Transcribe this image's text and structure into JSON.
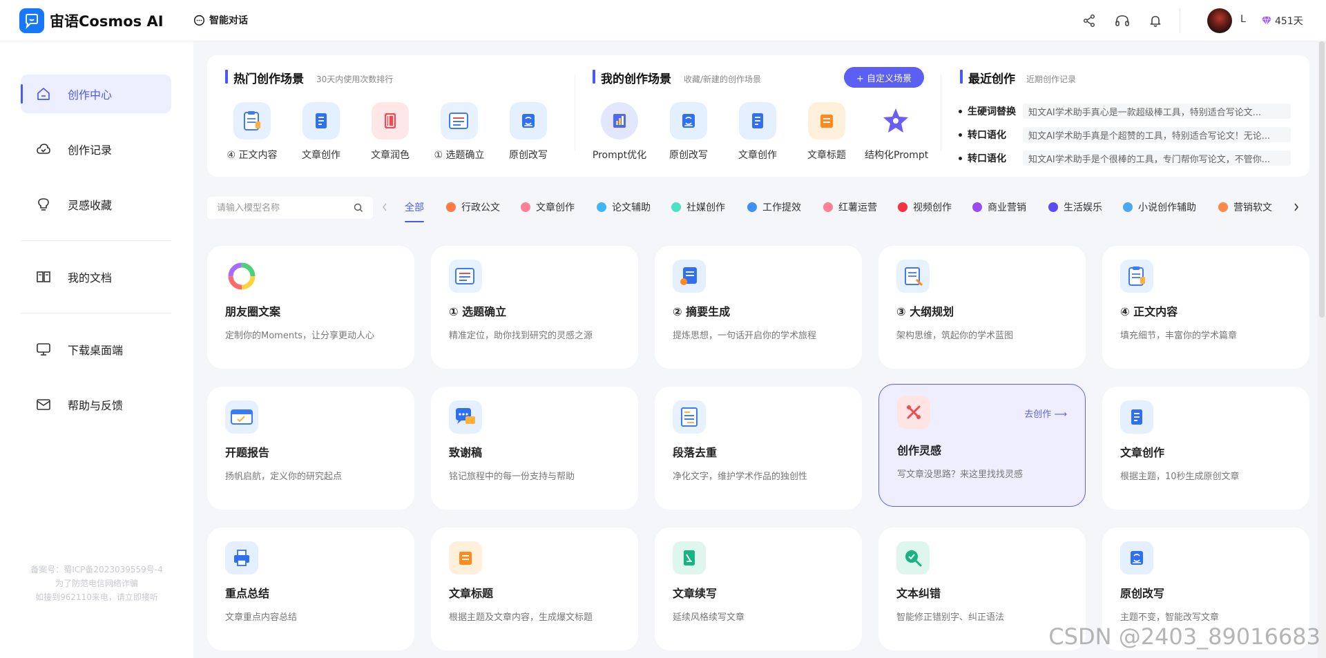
{
  "app": {
    "name": "宙语Cosmos AI",
    "nav_item": "智能对话"
  },
  "header": {
    "user_name": "L",
    "vip_days": "451天"
  },
  "sidebar": {
    "items": [
      {
        "label": "创作中心",
        "icon": "home-icon",
        "active": true
      },
      {
        "label": "创作记录",
        "icon": "cloud-icon"
      },
      {
        "label": "灵感收藏",
        "icon": "lightbulb-icon"
      },
      {
        "label": "我的文档",
        "icon": "book-icon"
      },
      {
        "label": "下载桌面端",
        "icon": "monitor-icon"
      },
      {
        "label": "帮助与反馈",
        "icon": "mail-icon"
      }
    ],
    "footer": [
      "备案号：蜀ICP备2023039559号-4",
      "为了防范电信网络诈骗",
      "如接到962110来电，请立即接听"
    ]
  },
  "hot": {
    "title": "热门创作场景",
    "subtitle": "30天内使用次数排行",
    "items": [
      {
        "label": "④ 正文内容",
        "icon": "clipboard-icon",
        "color": "#e7f0ff"
      },
      {
        "label": "文章创作",
        "icon": "document-icon",
        "color": "#e4efff"
      },
      {
        "label": "文章润色",
        "icon": "notebook-icon",
        "color": "#ffe7e7"
      },
      {
        "label": "① 选题确立",
        "icon": "checklist-icon",
        "color": "#e8f2ff"
      },
      {
        "label": "原创改写",
        "icon": "rewrite-icon",
        "color": "#e4f0ff"
      }
    ]
  },
  "mine": {
    "title": "我的创作场景",
    "subtitle": "收藏/新建的创作场景",
    "custom_button": "+ 自定义场景",
    "items": [
      {
        "label": "Prompt优化",
        "icon": "prompt-chart-icon",
        "color": "#e2e6ff"
      },
      {
        "label": "原创改写",
        "icon": "rewrite-icon",
        "color": "#e4f0ff"
      },
      {
        "label": "文章创作",
        "icon": "document-icon",
        "color": "#e4efff"
      },
      {
        "label": "文章标题",
        "icon": "title-book-icon",
        "color": "#fff0dc"
      },
      {
        "label": "结构化Prompt",
        "icon": "star-icon",
        "color": "#ffffff"
      }
    ]
  },
  "recent": {
    "title": "最近创作",
    "subtitle": "近期创作记录",
    "items": [
      {
        "tag": "生硬词替换",
        "text": "知文AI学术助手真心是一款超级棒工具，特别适合写论文..."
      },
      {
        "tag": "转口语化",
        "text": "知文AI学术助手真是个超赞的工具，特别适合写论文！无论..."
      },
      {
        "tag": "转口语化",
        "text": "知文AI学术助手是个很棒的工具，专门帮你写论文，不管你..."
      }
    ]
  },
  "search": {
    "placeholder": "请输入模型名称"
  },
  "categories": [
    {
      "label": "全部",
      "active": true
    },
    {
      "label": "行政公文",
      "color": "#ff7a45"
    },
    {
      "label": "文章创作",
      "color": "#ff7f96"
    },
    {
      "label": "论文辅助",
      "color": "#40b7f5"
    },
    {
      "label": "社媒创作",
      "color": "#4ee0c0"
    },
    {
      "label": "工作提效",
      "color": "#3c91f5"
    },
    {
      "label": "红薯运营",
      "color": "#ff7f96"
    },
    {
      "label": "视频创作",
      "color": "#f5333f"
    },
    {
      "label": "商业营销",
      "color": "#9b4cf0"
    },
    {
      "label": "生活娱乐",
      "color": "#5a4cf0"
    },
    {
      "label": "小说创作辅助",
      "color": "#4aa8f5"
    },
    {
      "label": "营销软文",
      "color": "#ff8a45"
    }
  ],
  "cards": [
    {
      "title": "朋友圈文案",
      "desc": "定制你的Moments，让分享更动人心",
      "icon": "ring-icon",
      "color": "#ffffff"
    },
    {
      "title": "① 选题确立",
      "desc": "精准定位，助你找到研究的灵感之源",
      "icon": "checklist-icon",
      "color": "#e8f2ff"
    },
    {
      "title": "② 摘要生成",
      "desc": "提炼思想，一句话开启你的学术旅程",
      "icon": "summary-icon",
      "color": "#e4efff"
    },
    {
      "title": "③ 大纲规划",
      "desc": "架构思维，筑起你的学术蓝图",
      "icon": "outline-icon",
      "color": "#e8f2ff"
    },
    {
      "title": "④ 正文内容",
      "desc": "填充细节，丰富你的学术篇章",
      "icon": "clipboard-icon",
      "color": "#e7f0ff"
    },
    {
      "title": "开题报告",
      "desc": "扬帆启航，定义你的研究起点",
      "icon": "report-icon",
      "color": "#e6f0ff"
    },
    {
      "title": "致谢稿",
      "desc": "铭记旅程中的每一份支持与帮助",
      "icon": "chat-icon",
      "color": "#e4efff"
    },
    {
      "title": "段落去重",
      "desc": "净化文字，维护学术作品的独创性",
      "icon": "dedupe-icon",
      "color": "#e8f2ff"
    },
    {
      "title": "创作灵感",
      "desc": "写文章没思路？来这里找找灵感",
      "icon": "inspiration-icon",
      "color": "#ffe4e4",
      "go": "去创作 ⟶",
      "highlight": true
    },
    {
      "title": "文章创作",
      "desc": "根据主题，10秒生成原创文章",
      "icon": "document-icon",
      "color": "#e4efff"
    },
    {
      "title": "重点总结",
      "desc": "文章重点内容总结",
      "icon": "printer-icon",
      "color": "#e4efff"
    },
    {
      "title": "文章标题",
      "desc": "根据主题及文章内容，生成爆文标题",
      "icon": "title-book-icon",
      "color": "#fff0dc"
    },
    {
      "title": "文章续写",
      "desc": "延续风格续写文章",
      "icon": "continue-icon",
      "color": "#dff6ee"
    },
    {
      "title": "文本纠错",
      "desc": "智能修正错别字、纠正语法",
      "icon": "correct-icon",
      "color": "#dff6ee"
    },
    {
      "title": "原创改写",
      "desc": "主题不变，智能改写文章",
      "icon": "rewrite-icon",
      "color": "#e4f0ff"
    }
  ],
  "watermark": "CSDN @2403_89016683"
}
